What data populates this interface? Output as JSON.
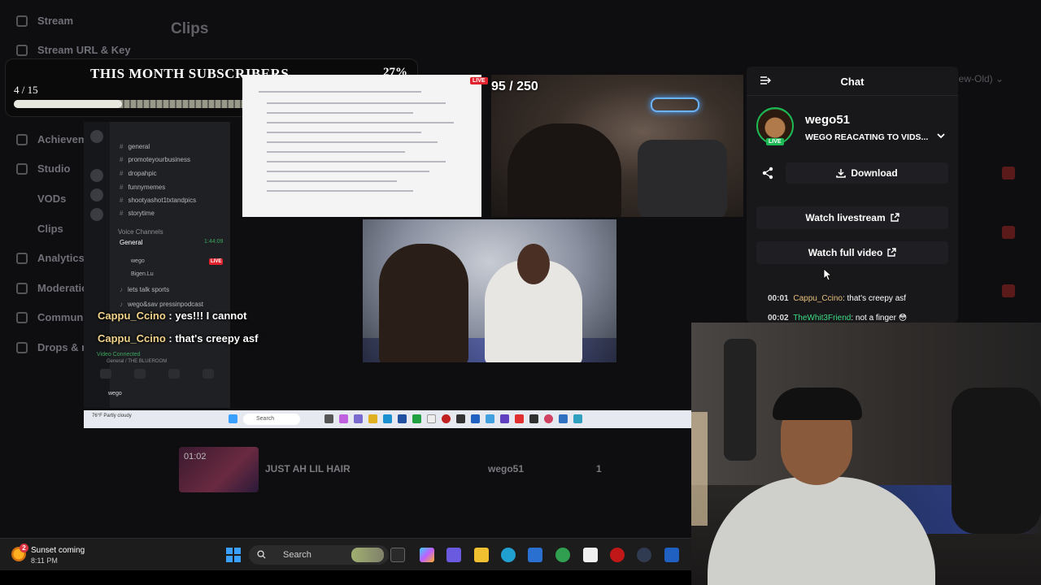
{
  "dashboard": {
    "sidebar": [
      {
        "label": "Stream"
      },
      {
        "label": "Stream URL & Key"
      },
      {
        "label": "Achievem"
      },
      {
        "label": "Studio"
      },
      {
        "label": "VODs"
      },
      {
        "label": "Clips"
      },
      {
        "label": "Analytics"
      },
      {
        "label": "Moderatio"
      },
      {
        "label": "Communi"
      },
      {
        "label": "Drops & re"
      }
    ],
    "page_title": "Clips",
    "sort_label": "New-Old)",
    "clip": {
      "duration": "01:02",
      "title": "JUST AH LIL HAIR",
      "author": "wego51",
      "count": "1"
    }
  },
  "sub_goal": {
    "title": "THIS MONTH SUBSCRIBERS",
    "percent": "27%",
    "count": "4 / 15",
    "progress": 0.27
  },
  "discord": {
    "channels": [
      "general",
      "promoteyourbusiness",
      "dropahpic",
      "funnymemes",
      "shootyashot1txtandpics",
      "storytime"
    ],
    "voice_header": "Voice Channels",
    "voice_general": "General",
    "voice_time": "1:44:09",
    "voice_users": [
      "wego",
      "Bigen.Lu"
    ],
    "live_label": "LIVE",
    "more_channels": [
      "lets talk sports",
      "wego&sav pressinpodcast"
    ],
    "video_connected": "Video Connected",
    "video_sub": "General / THE BLUEROOM",
    "user": "wego"
  },
  "overlay_chat": [
    {
      "name": "Cappu_Ccino",
      "text": " : yes!!! I cannot"
    },
    {
      "name": "Cappu_Ccino",
      "text": " : that's creepy asf"
    }
  ],
  "screenshare": {
    "live_label": "LIVE"
  },
  "cam_counter": "95 / 250",
  "chat_panel": {
    "title": "Chat",
    "streamer": "wego51",
    "live_badge": "LIVE",
    "stream_title": "WEGO REACATING TO VIDS...",
    "download_label": "Download",
    "watch_livestream_label": "Watch livestream",
    "watch_full_video_label": "Watch full video",
    "messages": [
      {
        "time": "00:01",
        "user": "Cappu_Ccino",
        "text": "that's creepy asf",
        "color": "#e8c07a"
      },
      {
        "time": "00:02",
        "user": "TheWhit3Friend",
        "text": "not a finger 😳",
        "color": "#3ddc84"
      }
    ]
  },
  "inner_taskbar": {
    "weather": "76°F Partly cloudy",
    "search_placeholder": "Search"
  },
  "taskbar": {
    "weather_badge": "2",
    "weather_text": "Sunset coming",
    "weather_time": "8:11 PM",
    "search_placeholder": "Search"
  },
  "colors": {
    "accent_green": "#1db954",
    "live_red": "#e0232d"
  }
}
